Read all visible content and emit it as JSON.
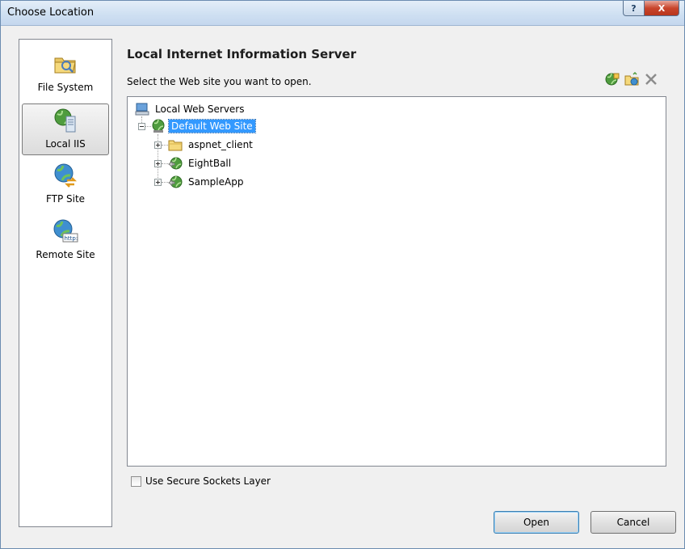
{
  "window": {
    "title": "Choose Location",
    "help_glyph": "?",
    "close_glyph": "X"
  },
  "locations": [
    {
      "label": "File System",
      "icon": "folder-icon",
      "active": false
    },
    {
      "label": "Local IIS",
      "icon": "iis-server-icon",
      "active": true
    },
    {
      "label": "FTP Site",
      "icon": "ftp-globe-icon",
      "active": false
    },
    {
      "label": "Remote Site",
      "icon": "http-globe-icon",
      "active": false
    }
  ],
  "main": {
    "heading": "Local Internet Information Server",
    "subtitle": "Select the Web site you want to open.",
    "toolbar": [
      "new-web-application-icon",
      "new-virtual-directory-icon",
      "delete-icon"
    ]
  },
  "tree": {
    "root": "Local Web Servers",
    "site": "Default Web Site",
    "children": [
      "aspnet_client",
      "EightBall",
      "SampleApp"
    ]
  },
  "options": {
    "ssl_label": "Use Secure Sockets Layer",
    "ssl_checked": false
  },
  "buttons": {
    "open": "Open",
    "cancel": "Cancel"
  },
  "colors": {
    "selection": "#3399ff",
    "window_border": "#6b8cb0",
    "close_button": "#c8452c"
  }
}
